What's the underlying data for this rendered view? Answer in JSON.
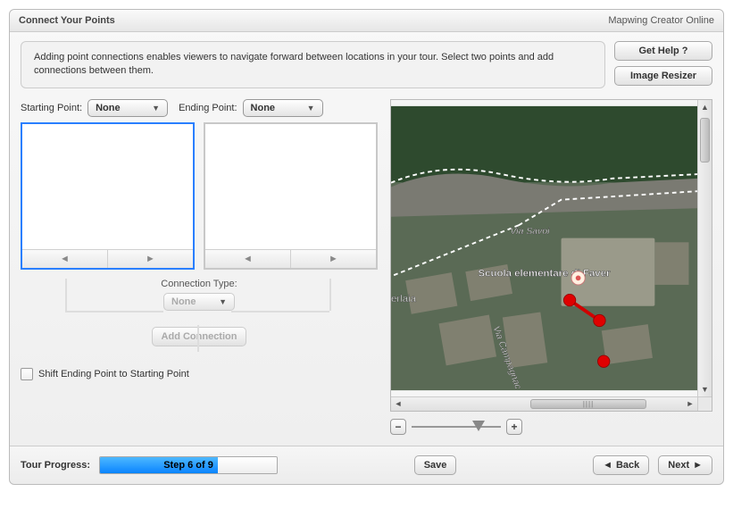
{
  "header": {
    "title": "Connect Your Points",
    "product": "Mapwing Creator Online"
  },
  "info_text": "Adding point connections enables viewers to navigate forward between locations in your tour. Select two points and add connections between them.",
  "side_buttons": {
    "help": "Get Help ?",
    "resizer": "Image Resizer"
  },
  "points": {
    "starting_label": "Starting Point:",
    "starting_value": "None",
    "ending_label": "Ending Point:",
    "ending_value": "None"
  },
  "connection": {
    "type_label": "Connection Type:",
    "type_value": "None",
    "add_label": "Add Connection"
  },
  "shift_checkbox_label": "Shift Ending Point to Starting Point",
  "map": {
    "road_label": "Via Savoi",
    "road_label_2": "Via Campagnac",
    "poi_label": "Scuola elementare di Faver",
    "area_label": "erlaia"
  },
  "zoom": {
    "minus": "−",
    "plus": "+"
  },
  "footer": {
    "progress_label": "Tour Progress:",
    "progress_text": "Step 6 of 9",
    "save": "Save",
    "back": "Back",
    "next": "Next"
  }
}
